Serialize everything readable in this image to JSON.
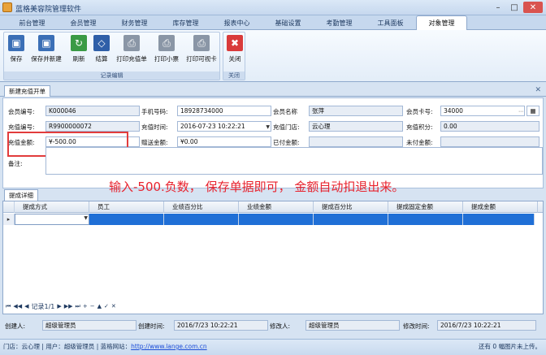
{
  "app": {
    "title": "蓝格美容院管理软件"
  },
  "menu_tabs": [
    "前台管理",
    "会员管理",
    "财务管理",
    "库存管理",
    "报表中心",
    "基础设置",
    "考勤管理",
    "工具面板",
    "对象管理"
  ],
  "ribbon": {
    "group1_label": "记录编辑",
    "group2_label": "关闭",
    "buttons": {
      "save": "保存",
      "save_new": "保存并新建",
      "refresh": "刷新",
      "settle": "结算",
      "print_recharge": "打印充值单",
      "print_receipt": "打印小票",
      "print_card": "打印可视卡",
      "close": "关闭"
    }
  },
  "doc_tab": {
    "label": "新建充值开单"
  },
  "form": {
    "labels": {
      "member_no": "会员编号:",
      "phone": "手机号码:",
      "member_name": "会员名称",
      "card_no": "会员卡号:",
      "recharge_no": "充值编号:",
      "recharge_time": "充值时间:",
      "store": "充值门店:",
      "points": "充值积分:",
      "amount": "充值金额:",
      "gift_amount": "赠送金额:",
      "paid": "已付金额:",
      "unpaid": "未付金额:",
      "memo": "备注:"
    },
    "values": {
      "member_no": "K000046",
      "phone": "18928734000",
      "member_name": "张萍",
      "card_no": "34000",
      "recharge_no": "R9900000072",
      "recharge_time": "2016-07-23 10:22:21",
      "store": "云心理",
      "points": "0.00",
      "amount": "¥-500.00",
      "gift_amount": "¥0.00",
      "paid": "",
      "unpaid": ""
    }
  },
  "annotation": "输入-500.负数，  保存单据即可，  金额自动扣退出来。",
  "detail_tab": "提成详细",
  "grid": {
    "headers": [
      "提成方式",
      "员工",
      "业绩百分比",
      "业绩金额",
      "提成百分比",
      "提成固定金额",
      "提成金额"
    ]
  },
  "nav": {
    "record": "记录1/1"
  },
  "footer": {
    "creator_label": "创建人:",
    "creator": "超级管理员",
    "created_label": "创建时间:",
    "created": "2016/7/23 10:22:21",
    "modifier_label": "修改人:",
    "modifier": "超级管理员",
    "modified_label": "修改时间:",
    "modified": "2016/7/23 10:22:21"
  },
  "status": {
    "store_label": "门店：",
    "store": "云心理",
    "user_label": "用户：",
    "user": "超级管理员",
    "site_label": "蓝格网站：",
    "site": "http://www.lange.com.cn",
    "right": "还有 0 幅图片未上传。"
  }
}
